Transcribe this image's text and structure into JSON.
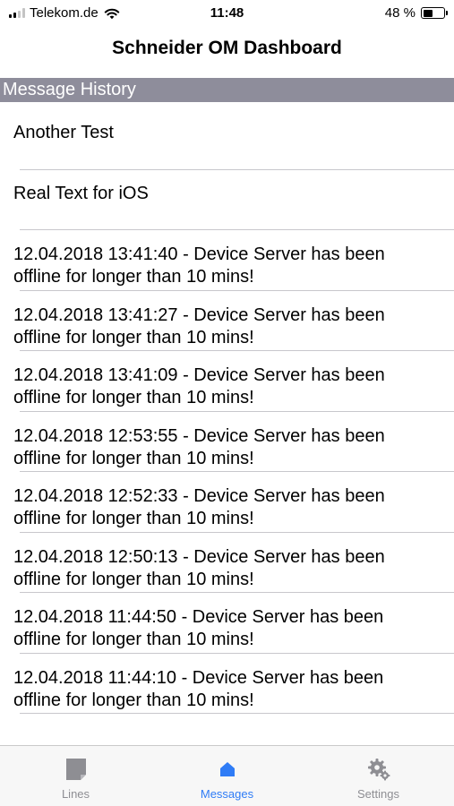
{
  "status_bar": {
    "carrier": "Telekom.de",
    "time": "11:48",
    "battery_percent": "48 %",
    "battery_level": 0.48
  },
  "nav": {
    "title": "Schneider OM Dashboard"
  },
  "section": {
    "title": "Message History"
  },
  "messages": [
    {
      "text": "Another Test"
    },
    {
      "text": "Real Text for iOS"
    },
    {
      "line1": "12.04.2018 13:41:40 - Device Server has been",
      "line2": "offline for longer than 10 mins!"
    },
    {
      "line1": "12.04.2018 13:41:27 - Device Server has been",
      "line2": "offline for longer than 10 mins!"
    },
    {
      "line1": "12.04.2018 13:41:09 - Device Server has been",
      "line2": "offline for longer than 10 mins!"
    },
    {
      "line1": "12.04.2018 12:53:55 - Device Server has been",
      "line2": "offline for longer than 10 mins!"
    },
    {
      "line1": "12.04.2018 12:52:33 - Device Server has been",
      "line2": "offline for longer than 10 mins!"
    },
    {
      "line1": "12.04.2018 12:50:13 - Device Server has been",
      "line2": "offline for longer than 10 mins!"
    },
    {
      "line1": "12.04.2018 11:44:50 - Device Server has been",
      "line2": "offline for longer than 10 mins!"
    },
    {
      "line1": "12.04.2018 11:44:10 - Device Server has been",
      "line2": "offline for longer than 10 mins!"
    }
  ],
  "tabs": [
    {
      "label": "Lines",
      "icon": "document-icon",
      "active": false
    },
    {
      "label": "Messages",
      "icon": "home-icon",
      "active": true
    },
    {
      "label": "Settings",
      "icon": "gear-icon",
      "active": false
    }
  ],
  "colors": {
    "section_header_bg": "#8e8d9b",
    "tab_active": "#2f7cf6",
    "tab_inactive": "#8e8e93",
    "separator": "#c8c7cc"
  }
}
